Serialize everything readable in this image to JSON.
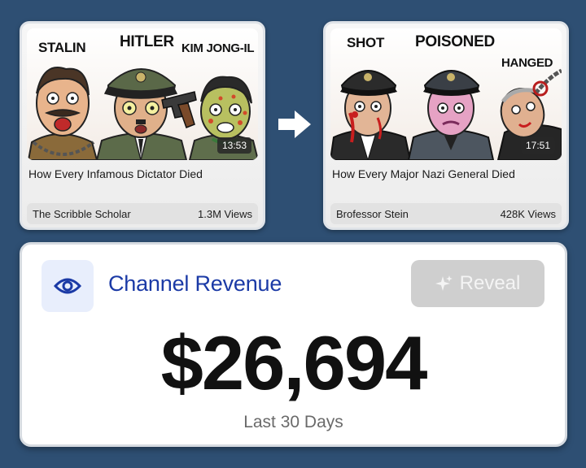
{
  "videos": [
    {
      "captions": [
        "STALIN",
        "HITLER",
        "KIM JONG-IL"
      ],
      "duration": "13:53",
      "title": "How Every Infamous Dictator Died",
      "channel": "The Scribble Scholar",
      "views": "1.3M Views"
    },
    {
      "captions": [
        "SHOT",
        "POISONED",
        "HANGED"
      ],
      "duration": "17:51",
      "title": "How Every Major Nazi General Died",
      "channel": "Brofessor Stein",
      "views": "428K Views"
    }
  ],
  "transition_icon": "arrow-right-icon",
  "revenue": {
    "icon": "eye-icon",
    "title": "Channel Revenue",
    "reveal_icon": "sparkle-icon",
    "reveal_label": "Reveal",
    "amount": "$26,694",
    "period": "Last 30 Days"
  },
  "colors": {
    "background": "#2e4f73",
    "accent": "#1b3aa6",
    "eye_box": "#e8eefc",
    "reveal_button": "#cfcfcf"
  }
}
